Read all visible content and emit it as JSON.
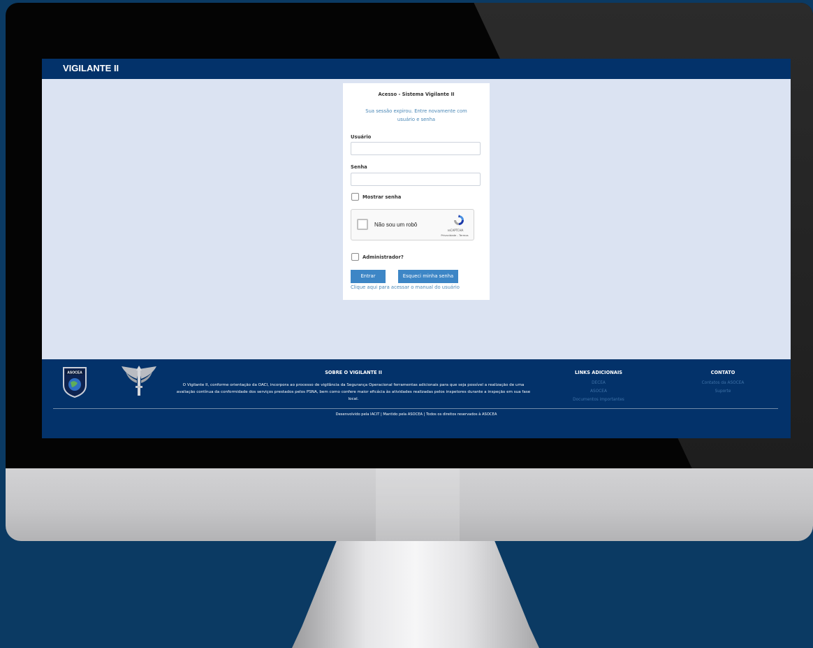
{
  "header": {
    "title": "VIGILANTE II"
  },
  "login": {
    "title": "Acesso - Sistema Vigilante II",
    "message": "Sua sessão expirou. Entre novamente com usuário e senha",
    "username_label": "Usuário",
    "username_value": "",
    "password_label": "Senha",
    "password_value": "",
    "show_password_label": "Mostrar senha",
    "show_password_checked": false,
    "recaptcha": {
      "label": "Não sou um robô",
      "brand": "reCAPTCHA",
      "links": "Privacidade - Termos"
    },
    "admin_label": "Administrador?",
    "admin_checked": false,
    "login_button": "Entrar",
    "forgot_button": "Esqueci minha senha",
    "manual_link": "Clique aqui para acessar o manual do usuário"
  },
  "footer": {
    "asocea_logo_text": "ASOCEA",
    "about_heading": "SOBRE O VIGILANTE II",
    "about_text": "O Vigilante II, conforme orientação da OACI, incorpora ao processo de vigilância da Segurança Operacional ferramentas adicionais para que seja possível a realização de uma avaliação contínua da conformidade dos serviços prestados pelos PSNA, bem como confere maior eficácia às atividades realizadas pelos inspetores durante a inspeção em sua fase local.",
    "links_heading": "LINKS ADICIONAIS",
    "links": [
      "DECEA",
      "ASOCEA",
      "Documentos importantes"
    ],
    "contact_heading": "CONTATO",
    "contact_links": [
      "Contatos da ASOCEA",
      "Suporte"
    ],
    "credits": "Desenvolvido pela IACIT | Mantido pela ASOCEA | Todos os direitos reservados à ASOCEA"
  },
  "colors": {
    "page_background": "#0b3a63",
    "header_blue": "#03326a",
    "screen_background": "#dbe3f2",
    "button_blue": "#3d86c6",
    "link_blue": "#4a87b6"
  }
}
